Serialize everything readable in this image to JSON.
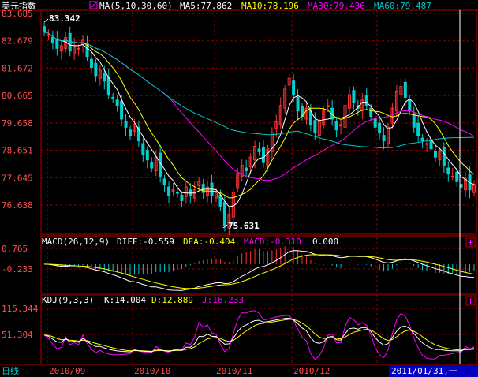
{
  "main": {
    "title": "美元指数",
    "ma_label": "MA(5,10,30,60)",
    "ma5": "MA5:77.862",
    "ma10": "MA10:78.196",
    "ma30": "MA30:79.436",
    "ma60": "MA60:79.487",
    "high_label": "83.342",
    "low_label": "75.631",
    "y_ticks": [
      "83.685",
      "82.679",
      "81.672",
      "80.665",
      "79.658",
      "78.651",
      "77.645",
      "76.638"
    ]
  },
  "macd": {
    "label": "MACD(26,12,9)",
    "diff": "DIFF:-0.559",
    "dea": "DEA:-0.404",
    "macd": "MACD:-0.310",
    "zero": "0.000",
    "y_ticks": [
      "0.765",
      "-0.233"
    ]
  },
  "kdj": {
    "label": "KDJ(9,3,3)",
    "k": "K:14.004",
    "d": "D:12.889",
    "j": "J:16.233",
    "y_ticks": [
      "115.344",
      "51.304"
    ]
  },
  "footer": {
    "period": "日线",
    "months": [
      "2010/09",
      "2010/10",
      "2010/11",
      "2010/12"
    ],
    "cursor_date": "2011/01/31,一"
  },
  "colors": {
    "bg": "#000000",
    "grid": "#8b0000",
    "border": "#b00000",
    "up": "#ff3232",
    "down": "#00d0d0",
    "ma5": "#ffffff",
    "ma10": "#ffff00",
    "ma30": "#ff00ff",
    "ma60": "#00c8c8",
    "axis_text": "#ff5050"
  },
  "chart_data": [
    {
      "type": "candlestick",
      "title": "美元指数",
      "ylim": [
        76.1,
        83.8
      ],
      "x": [
        "2010/09",
        "2010/10",
        "2010/11",
        "2010/12",
        "2011/01"
      ],
      "close": [
        83.0,
        82.9,
        82.6,
        82.4,
        82.5,
        82.8,
        82.3,
        82.5,
        82.4,
        82.7,
        82.1,
        81.7,
        81.4,
        81.6,
        81.2,
        80.7,
        80.6,
        80.3,
        79.8,
        79.5,
        79.2,
        79.6,
        79.0,
        78.5,
        78.3,
        78.0,
        78.4,
        77.7,
        77.4,
        77.0,
        77.2,
        77.1,
        76.8,
        77.3,
        77.0,
        77.2,
        77.5,
        77.1,
        77.3,
        77.0,
        77.1,
        76.6,
        75.9,
        76.3,
        77.1,
        77.8,
        78.1,
        77.9,
        78.4,
        78.8,
        78.6,
        78.2,
        78.7,
        79.3,
        79.7,
        80.3,
        80.9,
        81.3,
        80.7,
        80.1,
        79.9,
        80.2,
        79.6,
        79.3,
        79.7,
        80.1,
        80.3,
        79.8,
        79.4,
        79.6,
        80.3,
        80.7,
        80.4,
        80.2,
        80.5,
        80.3,
        79.9,
        79.5,
        79.3,
        79.0,
        79.5,
        80.2,
        80.8,
        81.0,
        80.6,
        80.1,
        79.5,
        79.2,
        79.0,
        78.9,
        78.7,
        78.4,
        78.6,
        78.1,
        77.8,
        77.7,
        77.5,
        77.3,
        77.6,
        77.2,
        77.4
      ],
      "series": [
        {
          "name": "MA5",
          "last": 77.862
        },
        {
          "name": "MA10",
          "last": 78.196
        },
        {
          "name": "MA30",
          "last": 79.436
        },
        {
          "name": "MA60",
          "last": 79.487
        }
      ],
      "annotations": [
        {
          "text": "83.342",
          "index": 2,
          "value": 83.342
        },
        {
          "text": "75.631",
          "index": 42,
          "value": 75.631
        }
      ]
    },
    {
      "type": "bar",
      "title": "MACD(26,12,9)",
      "ylim": [
        -0.9,
        1.0
      ],
      "series": [
        {
          "name": "DIFF",
          "last": -0.559
        },
        {
          "name": "DEA",
          "last": -0.404
        },
        {
          "name": "MACD",
          "last": -0.31
        }
      ]
    },
    {
      "type": "line",
      "title": "KDJ(9,3,3)",
      "ylim": [
        -5,
        125
      ],
      "series": [
        {
          "name": "K",
          "last": 14.004
        },
        {
          "name": "D",
          "last": 12.889
        },
        {
          "name": "J",
          "last": 16.233
        }
      ]
    }
  ]
}
